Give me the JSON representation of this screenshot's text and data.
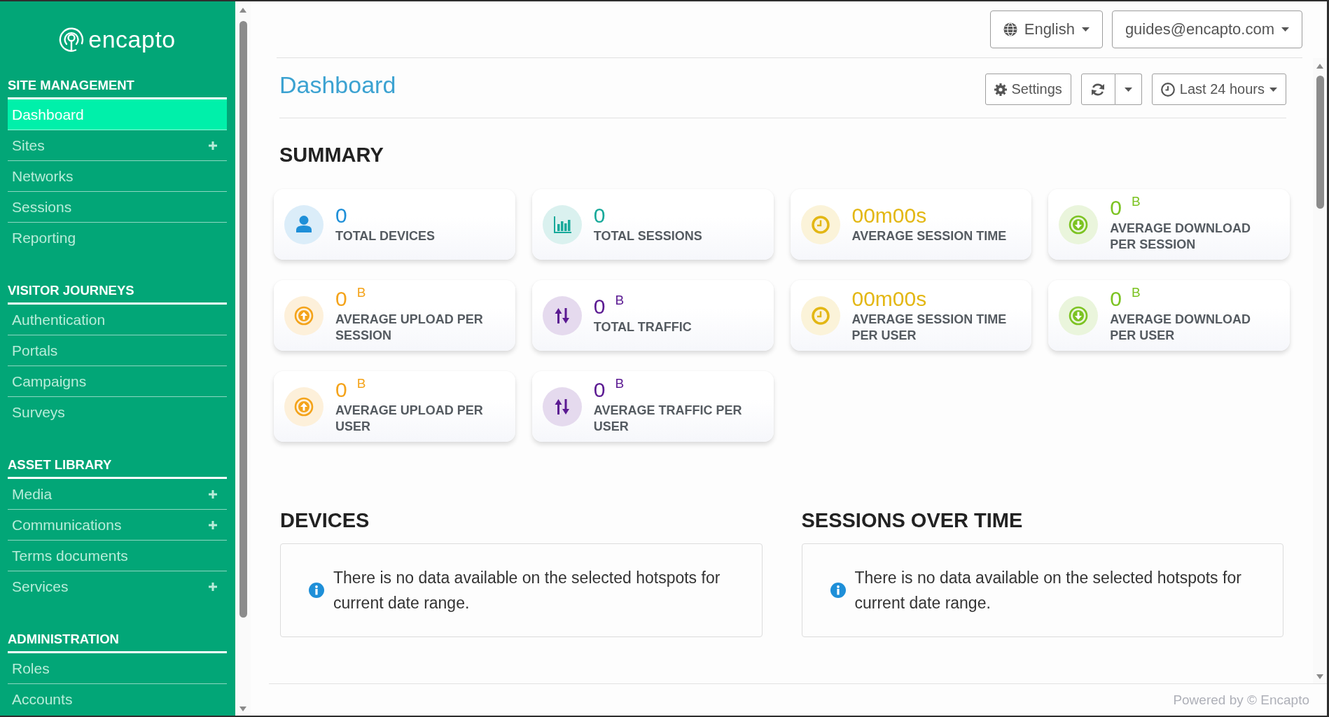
{
  "sidebar": {
    "logo": "encapto",
    "sections": [
      {
        "title": "SITE MANAGEMENT",
        "items": [
          {
            "label": "Dashboard",
            "selected": true,
            "expandable": false
          },
          {
            "label": "Sites",
            "selected": false,
            "expandable": true
          },
          {
            "label": "Networks",
            "selected": false,
            "expandable": false
          },
          {
            "label": "Sessions",
            "selected": false,
            "expandable": false
          },
          {
            "label": "Reporting",
            "selected": false,
            "expandable": false
          }
        ]
      },
      {
        "title": "VISITOR JOURNEYS",
        "items": [
          {
            "label": "Authentication",
            "selected": false,
            "expandable": false
          },
          {
            "label": "Portals",
            "selected": false,
            "expandable": false
          },
          {
            "label": "Campaigns",
            "selected": false,
            "expandable": false
          },
          {
            "label": "Surveys",
            "selected": false,
            "expandable": false
          }
        ]
      },
      {
        "title": "ASSET LIBRARY",
        "items": [
          {
            "label": "Media",
            "selected": false,
            "expandable": true
          },
          {
            "label": "Communications",
            "selected": false,
            "expandable": true
          },
          {
            "label": "Terms documents",
            "selected": false,
            "expandable": false
          },
          {
            "label": "Services",
            "selected": false,
            "expandable": true
          }
        ]
      },
      {
        "title": "ADMINISTRATION",
        "items": [
          {
            "label": "Roles",
            "selected": false,
            "expandable": false
          },
          {
            "label": "Accounts",
            "selected": false,
            "expandable": false
          }
        ]
      }
    ]
  },
  "topbar": {
    "language": "English",
    "account": "guides@encapto.com"
  },
  "page": {
    "title": "Dashboard",
    "toolbar": {
      "settings": "Settings",
      "time_range": "Last 24 hours"
    }
  },
  "summary": {
    "title": "SUMMARY",
    "cards": [
      {
        "kind": "person",
        "value": "0",
        "label": "TOTAL DEVICES",
        "color": "#1e8fd8"
      },
      {
        "kind": "bar-chart",
        "value": "0",
        "label": "TOTAL SESSIONS",
        "color": "#17a99a"
      },
      {
        "kind": "clock",
        "value": "00m00s",
        "label": "AVERAGE SESSION TIME",
        "color": "#e3b714"
      },
      {
        "kind": "download",
        "value": "0",
        "unit": "B",
        "label": "AVERAGE DOWNLOAD PER SESSION",
        "color": "#7cc322"
      },
      {
        "kind": "upload",
        "value": "0",
        "unit": "B",
        "label": "AVERAGE UPLOAD PER SESSION",
        "color": "#f4a31a"
      },
      {
        "kind": "traffic",
        "value": "0",
        "unit": "B",
        "label": "TOTAL TRAFFIC",
        "color": "#5b1a92"
      },
      {
        "kind": "clock",
        "value": "00m00s",
        "label": "AVERAGE SESSION TIME PER USER",
        "color": "#e3b714"
      },
      {
        "kind": "download",
        "value": "0",
        "unit": "B",
        "label": "AVERAGE DOWNLOAD PER USER",
        "color": "#7cc322"
      },
      {
        "kind": "upload",
        "value": "0",
        "unit": "B",
        "label": "AVERAGE UPLOAD PER USER",
        "color": "#f4a31a"
      },
      {
        "kind": "traffic",
        "value": "0",
        "unit": "B",
        "label": "AVERAGE TRAFFIC PER USER",
        "color": "#5b1a92"
      }
    ]
  },
  "panels": [
    {
      "title": "DEVICES",
      "message": "There is no data available on the selected hotspots for current date range."
    },
    {
      "title": "SESSIONS OVER TIME",
      "message": "There is no data available on the selected hotspots for current date range."
    }
  ],
  "footer": {
    "text": "Powered by © Encapto"
  }
}
